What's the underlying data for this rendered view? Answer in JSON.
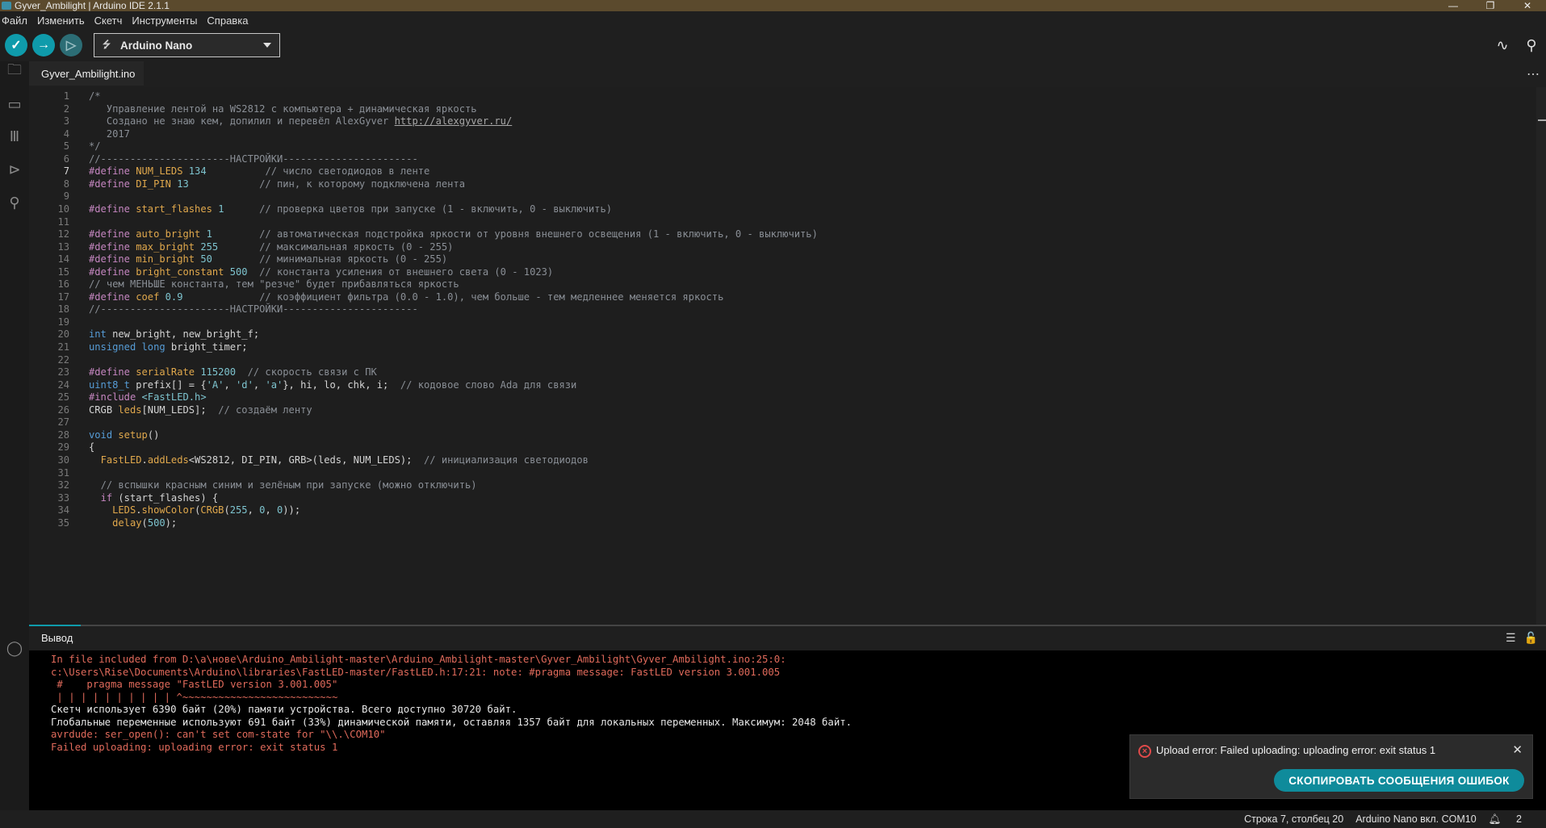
{
  "window": {
    "title": "Gyver_Ambilight | Arduino IDE 2.1.1",
    "controls": [
      "—",
      "❐",
      "✕"
    ]
  },
  "menu": [
    "Файл",
    "Изменить",
    "Скетч",
    "Инструменты",
    "Справка"
  ],
  "toolbar": {
    "board_label": "Arduino Nano",
    "verify_icon": "check-icon",
    "upload_icon": "arrow-right-icon",
    "debug_icon": "debug-icon"
  },
  "sidebar": {
    "icons": [
      "folder-icon",
      "board-icon",
      "library-icon",
      "debug-icon",
      "search-icon",
      "account-icon"
    ]
  },
  "tab": {
    "label": "Gyver_Ambilight.ino"
  },
  "editor": {
    "active_line": 7,
    "lines": [
      [
        {
          "t": "/*",
          "c": "c-com"
        }
      ],
      [
        {
          "t": "   Управление лентой на WS2812 с компьютера + динамическая яркость",
          "c": "c-com"
        }
      ],
      [
        {
          "t": "   Создано не знаю кем, допилил и перевёл AlexGyver ",
          "c": "c-com"
        },
        {
          "t": "http://alexgyver.ru/",
          "c": "c-lnk"
        }
      ],
      [
        {
          "t": "   2017",
          "c": "c-com"
        }
      ],
      [
        {
          "t": "*/",
          "c": "c-com"
        }
      ],
      [
        {
          "t": "//----------------------НАСТРОЙКИ-----------------------",
          "c": "c-com"
        }
      ],
      [
        {
          "t": "#define ",
          "c": "c-pp"
        },
        {
          "t": "NUM_LEDS",
          "c": "c-id"
        },
        {
          "t": " "
        },
        {
          "t": "134",
          "c": "c-num"
        },
        {
          "t": "          "
        },
        {
          "t": "// число светодиодов в ленте",
          "c": "c-com"
        }
      ],
      [
        {
          "t": "#define ",
          "c": "c-pp"
        },
        {
          "t": "DI_PIN",
          "c": "c-id"
        },
        {
          "t": " "
        },
        {
          "t": "13",
          "c": "c-num"
        },
        {
          "t": "            "
        },
        {
          "t": "// пин, к которому подключена лента",
          "c": "c-com"
        }
      ],
      [],
      [
        {
          "t": "#define ",
          "c": "c-pp"
        },
        {
          "t": "start_flashes",
          "c": "c-id"
        },
        {
          "t": " "
        },
        {
          "t": "1",
          "c": "c-num"
        },
        {
          "t": "      "
        },
        {
          "t": "// проверка цветов при запуске (1 - включить, 0 - выключить)",
          "c": "c-com"
        }
      ],
      [],
      [
        {
          "t": "#define ",
          "c": "c-pp"
        },
        {
          "t": "auto_bright",
          "c": "c-id"
        },
        {
          "t": " "
        },
        {
          "t": "1",
          "c": "c-num"
        },
        {
          "t": "        "
        },
        {
          "t": "// автоматическая подстройка яркости от уровня внешнего освещения (1 - включить, 0 - выключить)",
          "c": "c-com"
        }
      ],
      [
        {
          "t": "#define ",
          "c": "c-pp"
        },
        {
          "t": "max_bright",
          "c": "c-id"
        },
        {
          "t": " "
        },
        {
          "t": "255",
          "c": "c-num"
        },
        {
          "t": "       "
        },
        {
          "t": "// максимальная яркость (0 - 255)",
          "c": "c-com"
        }
      ],
      [
        {
          "t": "#define ",
          "c": "c-pp"
        },
        {
          "t": "min_bright",
          "c": "c-id"
        },
        {
          "t": " "
        },
        {
          "t": "50",
          "c": "c-num"
        },
        {
          "t": "        "
        },
        {
          "t": "// минимальная яркость (0 - 255)",
          "c": "c-com"
        }
      ],
      [
        {
          "t": "#define ",
          "c": "c-pp"
        },
        {
          "t": "bright_constant",
          "c": "c-id"
        },
        {
          "t": " "
        },
        {
          "t": "500",
          "c": "c-num"
        },
        {
          "t": "  "
        },
        {
          "t": "// константа усиления от внешнего света (0 - 1023)",
          "c": "c-com"
        }
      ],
      [
        {
          "t": "// чем МЕНЬШЕ константа, тем \"резче\" будет прибавляться яркость",
          "c": "c-com"
        }
      ],
      [
        {
          "t": "#define ",
          "c": "c-pp"
        },
        {
          "t": "coef",
          "c": "c-id"
        },
        {
          "t": " "
        },
        {
          "t": "0.9",
          "c": "c-num"
        },
        {
          "t": "             "
        },
        {
          "t": "// коэффициент фильтра (0.0 - 1.0), чем больше - тем медленнее меняется яркость",
          "c": "c-com"
        }
      ],
      [
        {
          "t": "//----------------------НАСТРОЙКИ-----------------------",
          "c": "c-com"
        }
      ],
      [],
      [
        {
          "t": "int",
          "c": "c-kw"
        },
        {
          "t": " new_bright, new_bright_f;"
        }
      ],
      [
        {
          "t": "unsigned long",
          "c": "c-kw"
        },
        {
          "t": " bright_timer;"
        }
      ],
      [],
      [
        {
          "t": "#define ",
          "c": "c-pp"
        },
        {
          "t": "serialRate",
          "c": "c-id"
        },
        {
          "t": " "
        },
        {
          "t": "115200",
          "c": "c-num"
        },
        {
          "t": "  "
        },
        {
          "t": "// скорость связи с ПК",
          "c": "c-com"
        }
      ],
      [
        {
          "t": "uint8_t",
          "c": "c-kw"
        },
        {
          "t": " prefix[] = {"
        },
        {
          "t": "'A'",
          "c": "c-str"
        },
        {
          "t": ", "
        },
        {
          "t": "'d'",
          "c": "c-str"
        },
        {
          "t": ", "
        },
        {
          "t": "'a'",
          "c": "c-str"
        },
        {
          "t": "}, hi, lo, chk, i;  "
        },
        {
          "t": "// кодовое слово Ada для связи",
          "c": "c-com"
        }
      ],
      [
        {
          "t": "#include ",
          "c": "c-pp"
        },
        {
          "t": "<FastLED.h>",
          "c": "c-str"
        }
      ],
      [
        {
          "t": "CRGB "
        },
        {
          "t": "leds",
          "c": "c-id"
        },
        {
          "t": "[NUM_LEDS];  "
        },
        {
          "t": "// создаём ленту",
          "c": "c-com"
        }
      ],
      [],
      [
        {
          "t": "void",
          "c": "c-kw"
        },
        {
          "t": " "
        },
        {
          "t": "setup",
          "c": "c-fn"
        },
        {
          "t": "()"
        }
      ],
      [
        {
          "t": "{"
        }
      ],
      [
        {
          "t": "  "
        },
        {
          "t": "FastLED",
          "c": "c-fn"
        },
        {
          "t": "."
        },
        {
          "t": "addLeds",
          "c": "c-fn"
        },
        {
          "t": "<WS2812, DI_PIN, GRB>(leds, NUM_LEDS);  "
        },
        {
          "t": "// инициализация светодиодов",
          "c": "c-com"
        }
      ],
      [],
      [
        {
          "t": "  "
        },
        {
          "t": "// вспышки красным синим и зелёным при запуске (можно отключить)",
          "c": "c-com"
        }
      ],
      [
        {
          "t": "  "
        },
        {
          "t": "if",
          "c": "c-pp"
        },
        {
          "t": " (start_flashes) {"
        }
      ],
      [
        {
          "t": "    "
        },
        {
          "t": "LEDS",
          "c": "c-fn"
        },
        {
          "t": "."
        },
        {
          "t": "showColor",
          "c": "c-fn"
        },
        {
          "t": "("
        },
        {
          "t": "CRGB",
          "c": "c-fn"
        },
        {
          "t": "("
        },
        {
          "t": "255",
          "c": "c-num"
        },
        {
          "t": ", "
        },
        {
          "t": "0",
          "c": "c-num"
        },
        {
          "t": ", "
        },
        {
          "t": "0",
          "c": "c-num"
        },
        {
          "t": "));"
        }
      ],
      [
        {
          "t": "    "
        },
        {
          "t": "delay",
          "c": "c-fn"
        },
        {
          "t": "("
        },
        {
          "t": "500",
          "c": "c-num"
        },
        {
          "t": ");"
        }
      ]
    ]
  },
  "output": {
    "tab_label": "Вывод",
    "lines": [
      {
        "t": "In file included from D:\\a\\нове\\Arduino_Ambilight-master\\Arduino_Ambilight-master\\Gyver_Ambilight\\Gyver_Ambilight.ino:25:0:",
        "c": "err"
      },
      {
        "t": "c:\\Users\\Rise\\Documents\\Arduino\\libraries\\FastLED-master/FastLED.h:17:21: note: #pragma message: FastLED version 3.001.005",
        "c": "err"
      },
      {
        "t": " #    pragma message \"FastLED version 3.001.005\"",
        "c": "err"
      },
      {
        "t": " | | | | | | | | | | ^~~~~~~~~~~~~~~~~~~~~~~~~~~",
        "c": "err"
      },
      {
        "t": "Скетч использует 6390 байт (20%) памяти устройства. Всего доступно 30720 байт.",
        "c": "std"
      },
      {
        "t": "Глобальные переменные используют 691 байт (33%) динамической памяти, оставляя 1357 байт для локальных переменных. Максимум: 2048 байт.",
        "c": "std"
      },
      {
        "t": "avrdude: ser_open(): can't set com-state for \"\\\\.\\COM10\"",
        "c": "err"
      },
      {
        "t": "Failed uploading: uploading error: exit status 1",
        "c": "err"
      }
    ]
  },
  "toast": {
    "message": "Upload error: Failed uploading: uploading error: exit status 1",
    "button": "СКОПИРОВАТЬ СООБЩЕНИЯ ОШИБОК",
    "close": "✕"
  },
  "statusbar": {
    "position": "Строка 7, столбец 20",
    "board": "Arduino Nano вкл. COM10",
    "notifications": "2"
  }
}
